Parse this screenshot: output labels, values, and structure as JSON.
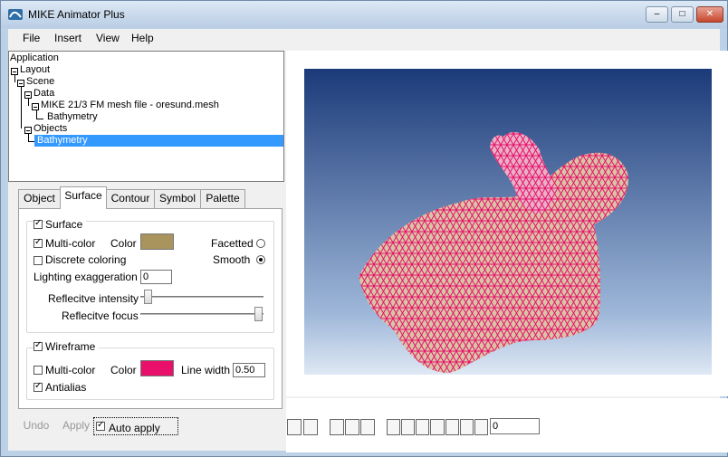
{
  "app": {
    "title": "MIKE Animator Plus"
  },
  "window_buttons": {
    "minimize": "–",
    "maximize": "□",
    "close": "✕"
  },
  "menu": [
    "File",
    "Insert",
    "View",
    "Help"
  ],
  "tree": {
    "items": [
      "Application",
      "Layout",
      "Scene",
      "Data",
      "MIKE 21/3 FM mesh file - oresund.mesh",
      "Bathymetry",
      "Objects",
      "Bathymetry"
    ]
  },
  "tabs": [
    "Object",
    "Surface",
    "Contour",
    "Symbol",
    "Palette"
  ],
  "surface_panel": {
    "surface_label": "Surface",
    "multicolor_label": "Multi-color",
    "color_label": "Color",
    "surface_color": "#a9945e",
    "facetted_label": "Facetted",
    "discrete_label": "Discrete coloring",
    "smooth_label": "Smooth",
    "lighting_label": "Lighting exaggeration",
    "lighting_value": "0",
    "reflective_intensity_label": "Reflecitve intensity",
    "reflective_focus_label": "Reflecitve focus",
    "wireframe_label": "Wireframe",
    "wire_multicolor_label": "Multi-color",
    "wire_color_label": "Color",
    "wire_color": "#e8106b",
    "line_width_label": "Line width",
    "line_width_value": "0.50",
    "antialias_label": "Antialias"
  },
  "actions": {
    "undo": "Undo",
    "apply": "Apply",
    "auto_apply": "Auto apply"
  },
  "animation": {
    "frame_value": "0"
  },
  "colors": {
    "viewport_top": "#1b3a79",
    "viewport_bottom": "#dfe8f4",
    "terrain": "#d8c5a5",
    "mesh": "#e8106b"
  }
}
